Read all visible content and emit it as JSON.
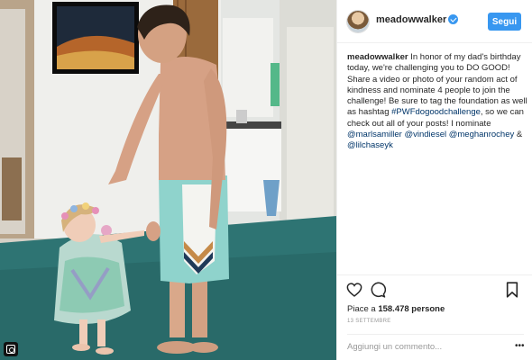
{
  "post": {
    "username": "meadowwalker",
    "follow_label": "Segui",
    "caption_prefix": "In honor of my dad's birthday today, we're challenging you to DO GOOD! Share a video or photo of your random act of kindness and nominate 4 people to join the challenge! Be sure to tag the foundation as well as hashtag ",
    "hashtag": "#PWFdogoodchallenge",
    "caption_middle": ", so we can check out all of your posts! I nominate ",
    "mention_1": "@marlsamiller",
    "mention_2": "@vindiesel",
    "mention_3": "@meghanrochey",
    "mention_sep": " & ",
    "mention_4": "@lilchaseyk",
    "likes_prefix": "Piace a ",
    "likes_count": "158.478 persone",
    "date": "13 settembre",
    "comment_placeholder": "Aggiungi un commento...",
    "more_glyph": "•••"
  },
  "icons": [
    "heart-icon",
    "comment-icon",
    "save-icon",
    "verified-badge-icon",
    "instagram-logo-icon",
    "more-options-icon"
  ],
  "colors": {
    "follow_button": "#3897f0",
    "verified_badge": "#3897f0",
    "link": "#003569",
    "text": "#262626",
    "muted": "#999999"
  }
}
